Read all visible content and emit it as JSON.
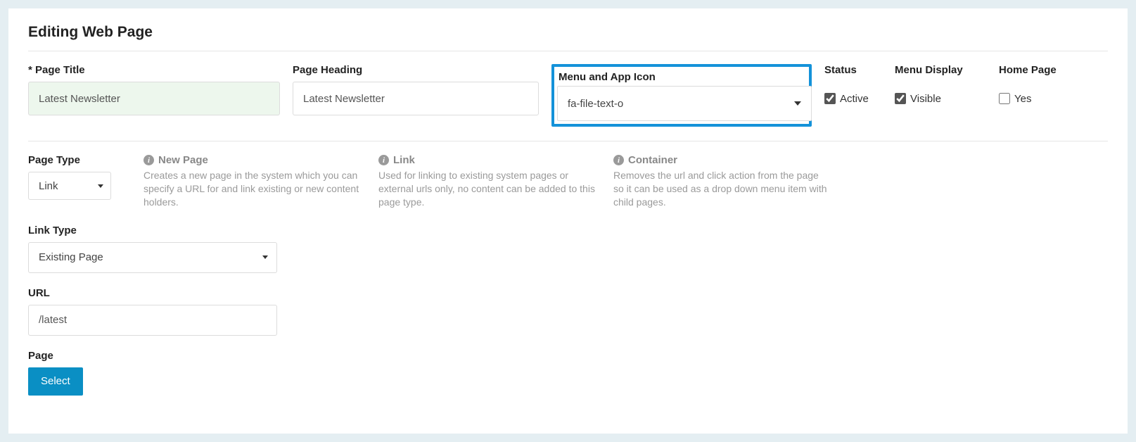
{
  "heading": "Editing Web Page",
  "fields": {
    "page_title": {
      "label": "* Page Title",
      "value": "Latest Newsletter"
    },
    "page_heading": {
      "label": "Page Heading",
      "value": "Latest Newsletter"
    },
    "menu_icon": {
      "label": "Menu and App Icon",
      "value": "fa-file-text-o"
    },
    "status": {
      "label": "Status",
      "option_label": "Active",
      "checked": true
    },
    "menu_display": {
      "label": "Menu Display",
      "option_label": "Visible",
      "checked": true
    },
    "home_page": {
      "label": "Home Page",
      "option_label": "Yes",
      "checked": false
    }
  },
  "page_type": {
    "label": "Page Type",
    "value": "Link",
    "descriptions": {
      "new_page": {
        "title": "New Page",
        "text": "Creates a new page in the system which you can specify a URL for and link existing or new content holders."
      },
      "link": {
        "title": "Link",
        "text": "Used for linking to existing system pages or external urls only, no content can be added to this page type."
      },
      "container": {
        "title": "Container",
        "text": "Removes the url and click action from the page so it can be used as a drop down menu item with child pages."
      }
    }
  },
  "link_type": {
    "label": "Link Type",
    "value": "Existing Page"
  },
  "url": {
    "label": "URL",
    "value": "/latest"
  },
  "page_field": {
    "label": "Page",
    "button": "Select"
  }
}
